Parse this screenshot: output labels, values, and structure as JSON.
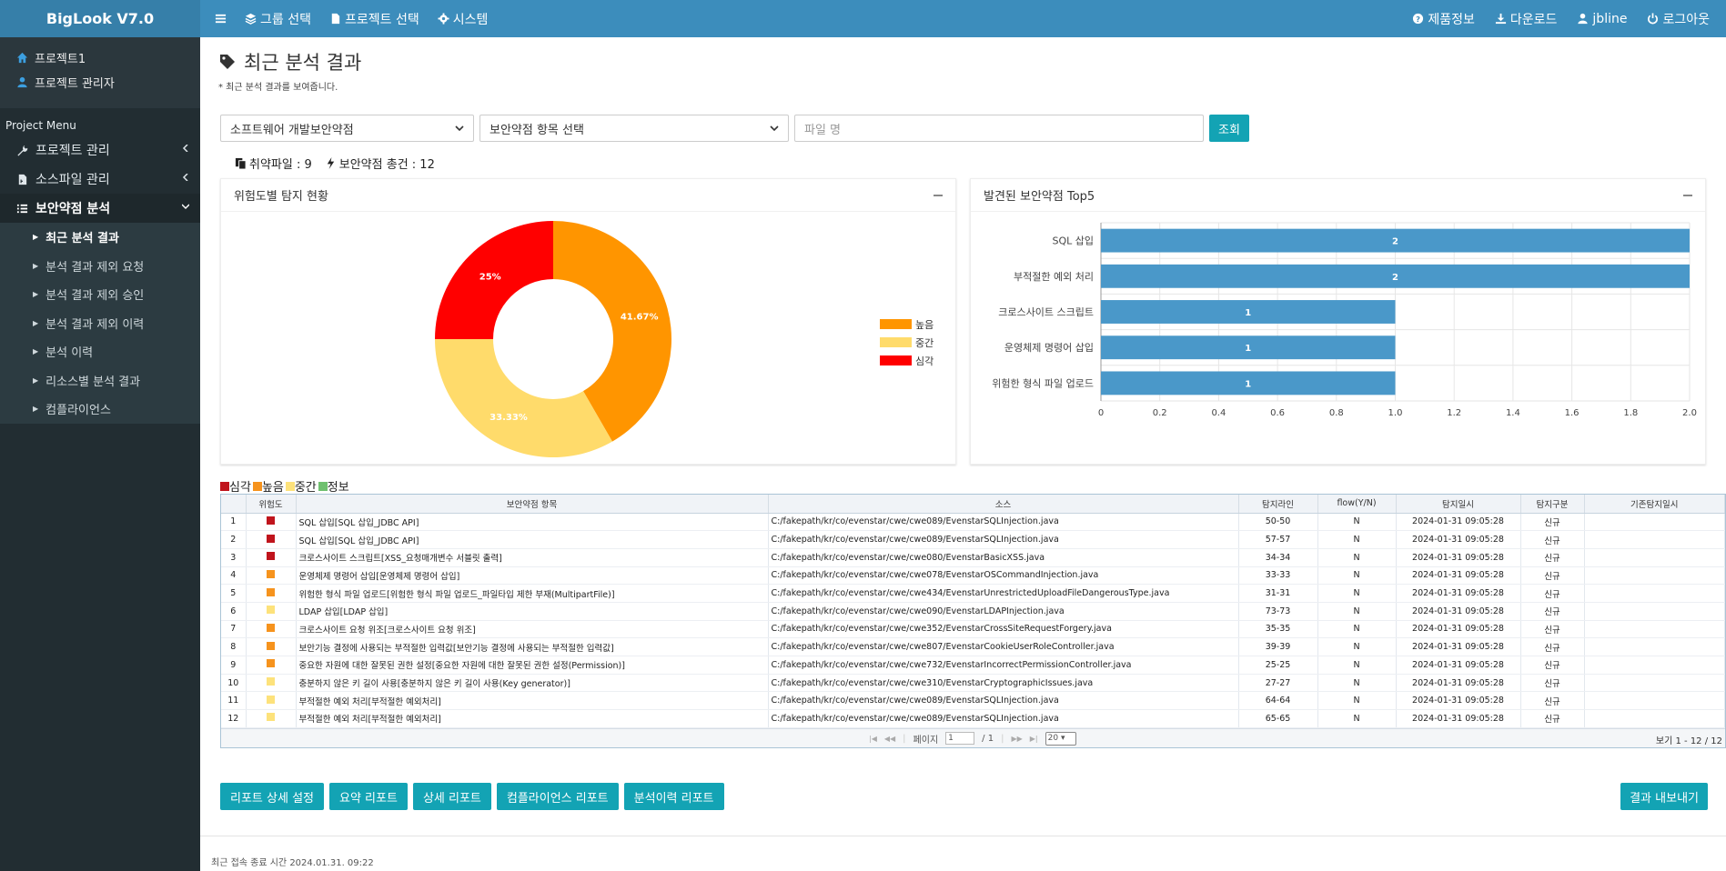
{
  "brand": "BigLook V7.0",
  "nav": {
    "left": [
      {
        "label": "그룹 선택",
        "icon": "layers-icon"
      },
      {
        "label": "프로젝트 선택",
        "icon": "file-icon"
      },
      {
        "label": "시스템",
        "icon": "gear-icon"
      }
    ],
    "right": [
      {
        "label": "제품정보",
        "icon": "question-circle-icon"
      },
      {
        "label": "다운로드",
        "icon": "download-icon"
      },
      {
        "label": "jbline",
        "icon": "user-icon"
      },
      {
        "label": "로그아웃",
        "icon": "power-icon"
      }
    ]
  },
  "sidebar": {
    "project": "프로젝트1",
    "admin": "프로젝트 관리자",
    "menu_header": "Project Menu",
    "items": [
      {
        "label": "프로젝트 관리",
        "icon": "wrench-icon"
      },
      {
        "label": "소스파일 관리",
        "icon": "file-code-icon"
      },
      {
        "label": "보안약점 분석",
        "icon": "list-check-icon"
      }
    ],
    "subitems": [
      "최근 분석 결과",
      "분석 결과 제외 요청",
      "분석 결과 제외 승인",
      "분석 결과 제외 이력",
      "분석 이력",
      "리소스별 분석 결과",
      "컴플라이언스"
    ]
  },
  "page": {
    "title": "최근 분석 결과",
    "subtitle": "* 최근 분석 결과를 보여줍니다."
  },
  "filters": {
    "category": "소프트웨어 개발보안약점",
    "item": "보안약점 항목 선택",
    "file_placeholder": "파일 명",
    "search_button": "조회"
  },
  "stats": {
    "files": "취약파일 : 9",
    "total": "보안약점 총건 : 12"
  },
  "pie_panel": {
    "title": "위험도별 탐지 현황"
  },
  "bar_panel": {
    "title": "발견된 보안약점 Top5"
  },
  "chart_data": [
    {
      "type": "pie",
      "title": "위험도별 탐지 현황",
      "labels": [
        "높음",
        "중간",
        "심각"
      ],
      "values": [
        41.67,
        33.33,
        25
      ],
      "value_labels": [
        "41.67%",
        "33.33%",
        "25%"
      ],
      "colors": [
        "#ff9500",
        "#ffdb6b",
        "#ff0000"
      ],
      "legend": "right"
    },
    {
      "type": "bar",
      "orientation": "horizontal",
      "title": "발견된 보안약점 Top5",
      "categories": [
        "SQL 삽입",
        "부적절한 예외 처리",
        "크로스사이트 스크립트",
        "운영체제 명령어 삽입",
        "위험한 형식 파일 업로드"
      ],
      "values": [
        2,
        2,
        1,
        1,
        1
      ],
      "xlim": [
        0,
        2.0
      ],
      "xticks": [
        "0",
        "0.2",
        "0.4",
        "0.6",
        "0.8",
        "1.0",
        "1.2",
        "1.4",
        "1.6",
        "1.8",
        "2.0"
      ],
      "color": "#4a98c9",
      "grid": true
    }
  ],
  "severity_legend": [
    {
      "label": "심각",
      "color": "#c0141c"
    },
    {
      "label": "높음",
      "color": "#f6931d"
    },
    {
      "label": "중간",
      "color": "#fde27b"
    },
    {
      "label": "정보",
      "color": "#6fc06f"
    }
  ],
  "table": {
    "headers": [
      "",
      "위험도",
      "보안약점 항목",
      "소스",
      "탐지라인",
      "flow(Y/N)",
      "탐지일시",
      "탐지구분",
      "기존탐지일시"
    ],
    "rows": [
      {
        "no": "1",
        "sev": "#c0141c",
        "item": "SQL 삽입[SQL 삽입_JDBC API]",
        "src": "C:/fakepath/kr/co/evenstar/cwe/cwe089/EvenstarSQLInjection.java",
        "line": "50-50",
        "flow": "N",
        "date": "2024-01-31 09:05:28",
        "kind": "신규",
        "prev": ""
      },
      {
        "no": "2",
        "sev": "#c0141c",
        "item": "SQL 삽입[SQL 삽입_JDBC API]",
        "src": "C:/fakepath/kr/co/evenstar/cwe/cwe089/EvenstarSQLInjection.java",
        "line": "57-57",
        "flow": "N",
        "date": "2024-01-31 09:05:28",
        "kind": "신규",
        "prev": ""
      },
      {
        "no": "3",
        "sev": "#c0141c",
        "item": "크로스사이트 스크립트[XSS_요청매개변수 서블릿 출력]",
        "src": "C:/fakepath/kr/co/evenstar/cwe/cwe080/EvenstarBasicXSS.java",
        "line": "34-34",
        "flow": "N",
        "date": "2024-01-31 09:05:28",
        "kind": "신규",
        "prev": ""
      },
      {
        "no": "4",
        "sev": "#f6931d",
        "item": "운영체제 명령어 삽입[운영체제 명령어 삽입]",
        "src": "C:/fakepath/kr/co/evenstar/cwe/cwe078/EvenstarOSCommandInjection.java",
        "line": "33-33",
        "flow": "N",
        "date": "2024-01-31 09:05:28",
        "kind": "신규",
        "prev": ""
      },
      {
        "no": "5",
        "sev": "#f6931d",
        "item": "위험한 형식 파일 업로드[위험한 형식 파일 업로드_파일타입 제한 부재(MultipartFile)]",
        "src": "C:/fakepath/kr/co/evenstar/cwe/cwe434/EvenstarUnrestrictedUploadFileDangerousType.java",
        "line": "31-31",
        "flow": "N",
        "date": "2024-01-31 09:05:28",
        "kind": "신규",
        "prev": ""
      },
      {
        "no": "6",
        "sev": "#fde27b",
        "item": "LDAP 삽입[LDAP 삽입]",
        "src": "C:/fakepath/kr/co/evenstar/cwe/cwe090/EvenstarLDAPInjection.java",
        "line": "73-73",
        "flow": "N",
        "date": "2024-01-31 09:05:28",
        "kind": "신규",
        "prev": ""
      },
      {
        "no": "7",
        "sev": "#f6931d",
        "item": "크로스사이트 요청 위조[크로스사이트 요청 위조]",
        "src": "C:/fakepath/kr/co/evenstar/cwe/cwe352/EvenstarCrossSiteRequestForgery.java",
        "line": "35-35",
        "flow": "N",
        "date": "2024-01-31 09:05:28",
        "kind": "신규",
        "prev": ""
      },
      {
        "no": "8",
        "sev": "#f6931d",
        "item": "보안기능 결정에 사용되는 부적절한 입력값[보안기능 결정에 사용되는 부적절한 입력값]",
        "src": "C:/fakepath/kr/co/evenstar/cwe/cwe807/EvenstarCookieUserRoleController.java",
        "line": "39-39",
        "flow": "N",
        "date": "2024-01-31 09:05:28",
        "kind": "신규",
        "prev": ""
      },
      {
        "no": "9",
        "sev": "#f6931d",
        "item": "중요한 자원에 대한 잘못된 권한 설정[중요한 자원에 대한 잘못된 권한 설정(Permission)]",
        "src": "C:/fakepath/kr/co/evenstar/cwe/cwe732/EvenstarIncorrectPermissionController.java",
        "line": "25-25",
        "flow": "N",
        "date": "2024-01-31 09:05:28",
        "kind": "신규",
        "prev": ""
      },
      {
        "no": "10",
        "sev": "#fde27b",
        "item": "충분하지 않은 키 길이 사용[충분하지 않은 키 길이 사용(Key generator)]",
        "src": "C:/fakepath/kr/co/evenstar/cwe/cwe310/EvenstarCryptographicIssues.java",
        "line": "27-27",
        "flow": "N",
        "date": "2024-01-31 09:05:28",
        "kind": "신규",
        "prev": ""
      },
      {
        "no": "11",
        "sev": "#fde27b",
        "item": "부적절한 예외 처리[부적절한 예외처리]",
        "src": "C:/fakepath/kr/co/evenstar/cwe/cwe089/EvenstarSQLInjection.java",
        "line": "64-64",
        "flow": "N",
        "date": "2024-01-31 09:05:28",
        "kind": "신규",
        "prev": ""
      },
      {
        "no": "12",
        "sev": "#fde27b",
        "item": "부적절한 예외 처리[부적절한 예외처리]",
        "src": "C:/fakepath/kr/co/evenstar/cwe/cwe089/EvenstarSQLInjection.java",
        "line": "65-65",
        "flow": "N",
        "date": "2024-01-31 09:05:28",
        "kind": "신규",
        "prev": ""
      }
    ]
  },
  "pager": {
    "page_label": "페이지",
    "page_value": "1",
    "page_total": "/ 1",
    "rows_per_page": "20",
    "summary": "보기 1 - 12 / 12"
  },
  "buttons": {
    "report_settings": "리포트 상세 설정",
    "summary_report": "요약 리포트",
    "detail_report": "상세 리포트",
    "compliance_report": "컴플라이언스 리포트",
    "history_report": "분석이력 리포트",
    "export": "결과 내보내기"
  },
  "footer": "최근 접속 종료 시간 2024.01.31. 09:22"
}
